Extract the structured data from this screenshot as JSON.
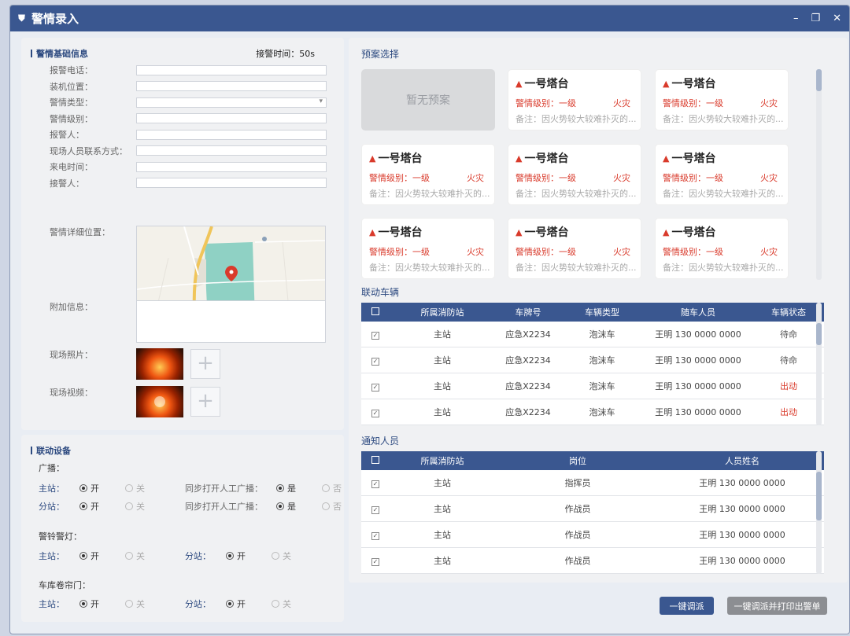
{
  "window": {
    "title": "警情录入",
    "icon": "shield-icon",
    "controls": [
      "–",
      "❐",
      "✕"
    ]
  },
  "basic": {
    "title": "警情基础信息",
    "timer_label": "接警时间：50s",
    "fields": [
      "报警电话：",
      "装机位置：",
      "警情类型：",
      "警情级别：",
      "报警人：",
      "现场人员联系方式：",
      "来电时间：",
      "接警人：",
      "警情详细位置："
    ],
    "extra_label": "附加信息：",
    "photo_label": "现场照片：",
    "video_label": "现场视频："
  },
  "devices": {
    "title": "联动设备",
    "broadcast": {
      "title": "广播：",
      "rows": [
        {
          "label": "主站：",
          "open": "开",
          "close": "关",
          "sync_label": "同步打开人工广播：",
          "yes": "是",
          "no": "否",
          "selected": "开",
          "sync_selected": "是"
        },
        {
          "label": "分站：",
          "open": "开",
          "close": "关",
          "sync_label": "同步打开人工广播：",
          "yes": "是",
          "no": "否",
          "selected": "开",
          "sync_selected": "是"
        }
      ]
    },
    "alarm": {
      "title": "警铃警灯：",
      "main_label": "主站：",
      "sub_label": "分站：",
      "open": "开",
      "close": "关"
    },
    "garage": {
      "title": "车库卷帘门：",
      "main_label": "主站：",
      "sub_label": "分站：",
      "open": "开",
      "close": "关"
    }
  },
  "plans": {
    "title": "预案选择",
    "empty": "暂无预案",
    "items": [
      {
        "name": "一号塔台",
        "level": "警情级别：一级",
        "type": "火灾",
        "remark": "备注：因火势较大较难扑灭的..."
      },
      {
        "name": "一号塔台",
        "level": "警情级别：一级",
        "type": "火灾",
        "remark": "备注：因火势较大较难扑灭的..."
      },
      {
        "name": "一号塔台",
        "level": "警情级别：一级",
        "type": "火灾",
        "remark": "备注：因火势较大较难扑灭的..."
      },
      {
        "name": "一号塔台",
        "level": "警情级别：一级",
        "type": "火灾",
        "remark": "备注：因火势较大较难扑灭的..."
      },
      {
        "name": "一号塔台",
        "level": "警情级别：一级",
        "type": "火灾",
        "remark": "备注：因火势较大较难扑灭的..."
      },
      {
        "name": "一号塔台",
        "level": "警情级别：一级",
        "type": "火灾",
        "remark": "备注：因火势较大较难扑灭的..."
      },
      {
        "name": "一号塔台",
        "level": "警情级别：一级",
        "type": "火灾",
        "remark": "备注：因火势较大较难扑灭的..."
      },
      {
        "name": "一号塔台",
        "level": "警情级别：一级",
        "type": "火灾",
        "remark": "备注：因火势较大较难扑灭的..."
      }
    ]
  },
  "vehicles": {
    "title": "联动车辆",
    "headers": [
      "所属消防站",
      "车牌号",
      "车辆类型",
      "随车人员",
      "车辆状态"
    ],
    "rows": [
      {
        "station": "主站",
        "plate": "应急X2234",
        "type": "泡沫车",
        "crew": "王明  130 0000 0000",
        "status": "待命",
        "status_color": "#555555"
      },
      {
        "station": "主站",
        "plate": "应急X2234",
        "type": "泡沫车",
        "crew": "王明  130 0000 0000",
        "status": "待命",
        "status_color": "#555555"
      },
      {
        "station": "主站",
        "plate": "应急X2234",
        "type": "泡沫车",
        "crew": "王明  130 0000 0000",
        "status": "出动",
        "status_color": "#d93a2b"
      },
      {
        "station": "主站",
        "plate": "应急X2234",
        "type": "泡沫车",
        "crew": "王明  130 0000 0000",
        "status": "出动",
        "status_color": "#d93a2b"
      }
    ]
  },
  "personnel": {
    "title": "通知人员",
    "headers": [
      "所属消防站",
      "岗位",
      "人员姓名"
    ],
    "rows": [
      {
        "station": "主站",
        "post": "指挥员",
        "name": "王明  130 0000 0000"
      },
      {
        "station": "主站",
        "post": "作战员",
        "name": "王明  130 0000 0000"
      },
      {
        "station": "主站",
        "post": "作战员",
        "name": "王明  130 0000 0000"
      },
      {
        "station": "主站",
        "post": "作战员",
        "name": "王明  130 0000 0000"
      }
    ]
  },
  "buttons": {
    "dispatch": "一键调派",
    "dispatch_print": "一键调派并打印出警单"
  },
  "colors": {
    "titlebar": "#3a5790",
    "alert": "#d93a2b"
  }
}
